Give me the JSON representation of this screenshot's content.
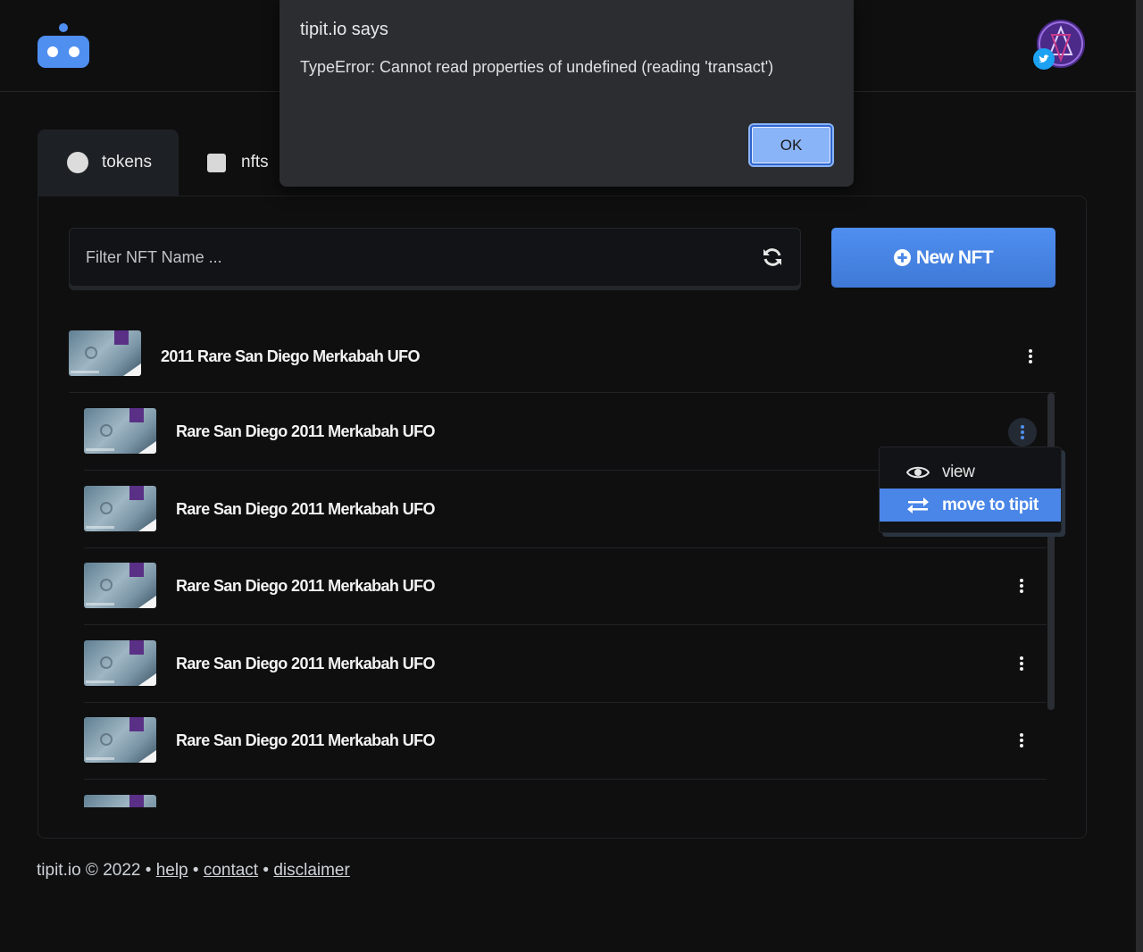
{
  "tabs": {
    "tokens_label": "tokens",
    "nfts_label": "nfts"
  },
  "filter": {
    "placeholder": "Filter NFT Name ...",
    "refresh_icon": "refresh-icon"
  },
  "new_nft_button": {
    "label": "New NFT",
    "icon": "plus-circle-icon"
  },
  "list": {
    "parent_title": "2011 Rare San Diego Merkabah UFO",
    "children": [
      {
        "title": "Rare San Diego 2011 Merkabah UFO"
      },
      {
        "title": "Rare San Diego 2011 Merkabah UFO"
      },
      {
        "title": "Rare San Diego 2011 Merkabah UFO"
      },
      {
        "title": "Rare San Diego 2011 Merkabah UFO"
      },
      {
        "title": "Rare San Diego 2011 Merkabah UFO"
      }
    ]
  },
  "menu": {
    "view_label": "view",
    "move_label": "move to tipit"
  },
  "dialog": {
    "title": "tipit.io says",
    "message": "TypeError: Cannot read properties of undefined (reading 'transact')",
    "ok_label": "OK"
  },
  "footer": {
    "copyright": "tipit.io © 2022",
    "sep": "•",
    "help": "help",
    "contact": "contact",
    "disclaimer": "disclaimer"
  },
  "colors": {
    "accent": "#4a86e8",
    "background": "#0f0f10",
    "dialog": "#2b2d31"
  }
}
